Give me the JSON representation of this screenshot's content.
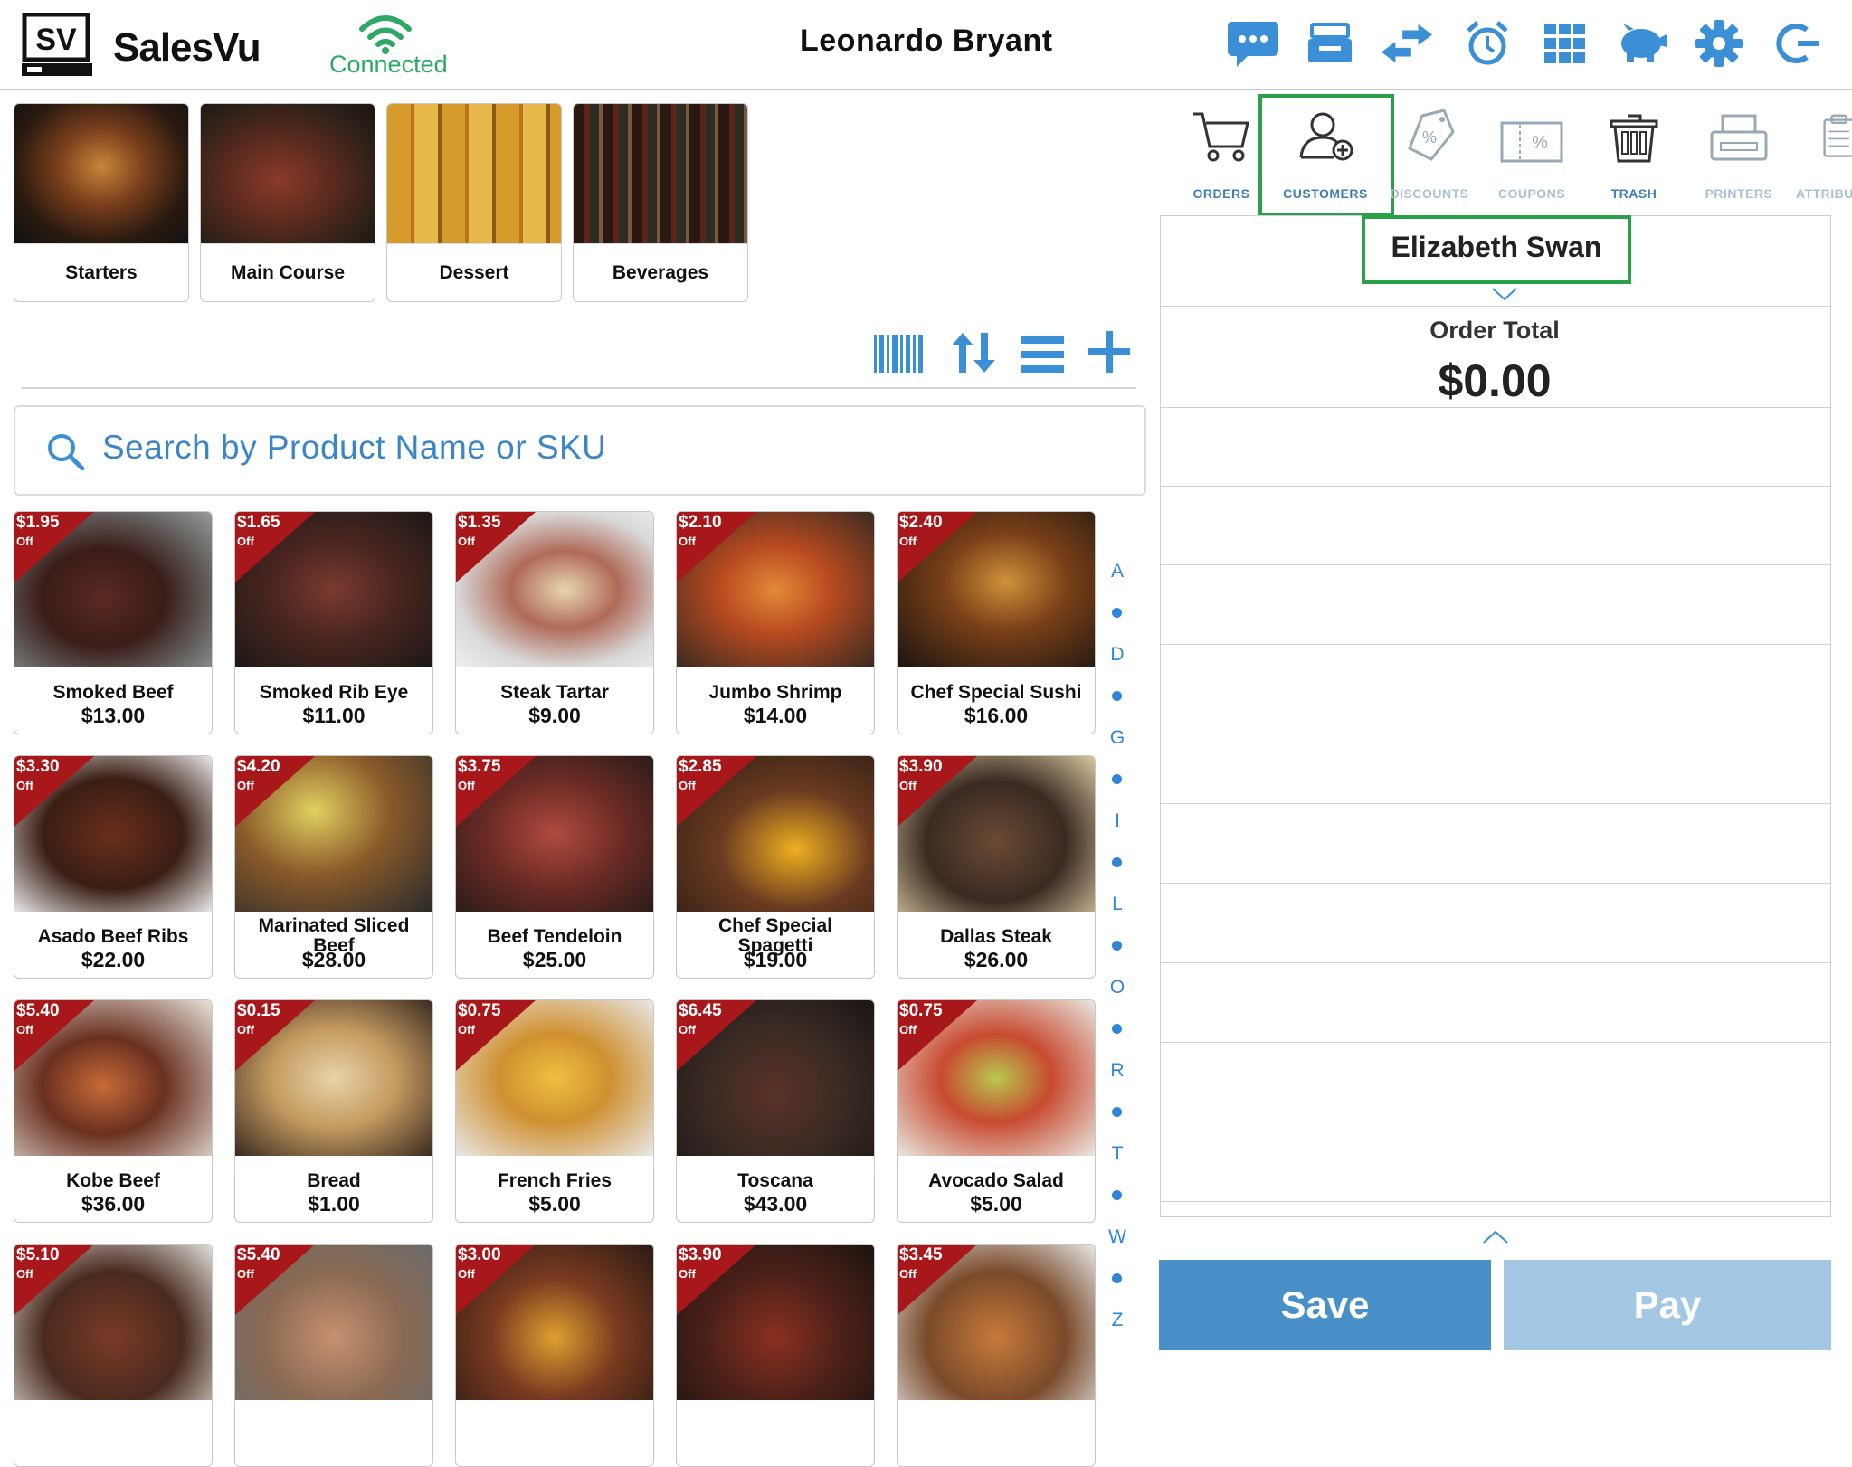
{
  "header": {
    "logo_text": "SV",
    "brand": "SalesVu",
    "connection_status": "Connected",
    "user_name": "Leonardo Bryant",
    "icons": [
      "chat-icon",
      "drawer-icon",
      "transfer-icon",
      "alarm-icon",
      "grid-icon",
      "piggy-bank-icon",
      "gear-icon",
      "logout-icon"
    ]
  },
  "categories": [
    {
      "label": "Starters"
    },
    {
      "label": "Main Course"
    },
    {
      "label": "Dessert"
    },
    {
      "label": "Beverages"
    }
  ],
  "toolbar": {
    "icons": [
      "barcode-icon",
      "sort-icon",
      "list-view-icon",
      "add-icon"
    ]
  },
  "search": {
    "placeholder": "Search by Product Name or SKU"
  },
  "badge_off": "Off",
  "products": [
    {
      "name": "Smoked Beef",
      "price": "$13.00",
      "discount": "$1.95"
    },
    {
      "name": "Smoked Rib Eye",
      "price": "$11.00",
      "discount": "$1.65"
    },
    {
      "name": "Steak Tartar",
      "price": "$9.00",
      "discount": "$1.35"
    },
    {
      "name": "Jumbo Shrimp",
      "price": "$14.00",
      "discount": "$2.10"
    },
    {
      "name": "Chef Special Sushi",
      "price": "$16.00",
      "discount": "$2.40"
    },
    {
      "name": "Asado Beef Ribs",
      "price": "$22.00",
      "discount": "$3.30"
    },
    {
      "name": "Marinated Sliced Beef",
      "price": "$28.00",
      "discount": "$4.20"
    },
    {
      "name": "Beef Tendeloin",
      "price": "$25.00",
      "discount": "$3.75"
    },
    {
      "name": "Chef Special Spagetti",
      "price": "$19.00",
      "discount": "$2.85"
    },
    {
      "name": "Dallas Steak",
      "price": "$26.00",
      "discount": "$3.90"
    },
    {
      "name": "Kobe Beef",
      "price": "$36.00",
      "discount": "$5.40"
    },
    {
      "name": "Bread",
      "price": "$1.00",
      "discount": "$0.15"
    },
    {
      "name": "French Fries",
      "price": "$5.00",
      "discount": "$0.75"
    },
    {
      "name": "Toscana",
      "price": "$43.00",
      "discount": "$6.45"
    },
    {
      "name": "Avocado Salad",
      "price": "$5.00",
      "discount": "$0.75"
    },
    {
      "name": "",
      "price": "",
      "discount": "$5.10"
    },
    {
      "name": "",
      "price": "",
      "discount": "$5.40"
    },
    {
      "name": "",
      "price": "",
      "discount": "$3.00"
    },
    {
      "name": "",
      "price": "",
      "discount": "$3.90"
    },
    {
      "name": "",
      "price": "",
      "discount": "$3.45"
    }
  ],
  "alphabet": [
    "A",
    "D",
    "G",
    "I",
    "L",
    "O",
    "R",
    "T",
    "W",
    "Z"
  ],
  "right_tabs": [
    {
      "label": "ORDERS"
    },
    {
      "label": "CUSTOMERS"
    },
    {
      "label": "DISCOUNTS"
    },
    {
      "label": "COUPONS"
    },
    {
      "label": "TRASH"
    },
    {
      "label": "PRINTERS"
    },
    {
      "label": "ATTRIBU"
    }
  ],
  "order": {
    "customer": "Elizabeth Swan",
    "total_label": "Order Total",
    "total_value": "$0.00"
  },
  "actions": {
    "save": "Save",
    "pay": "Pay"
  },
  "colors": {
    "accent": "#2f86d6",
    "selected": "#2aa049",
    "badge": "#a8181b",
    "connected": "#2fa866"
  }
}
